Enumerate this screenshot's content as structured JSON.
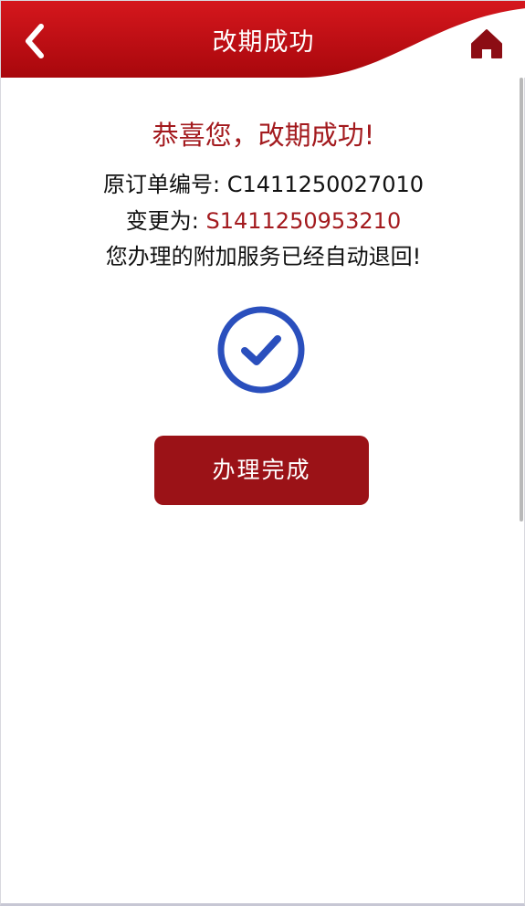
{
  "header": {
    "title": "改期成功",
    "back_icon": "chevron-left-icon",
    "home_icon": "home-icon",
    "bg_color": "#c8141a",
    "curve_color": "#ffffff"
  },
  "message": {
    "congrats": "恭喜您，改期成功!",
    "original_order_label": "原订单编号:",
    "original_order_no": "C1411250027010",
    "changed_to_label": "变更为:",
    "changed_to_no": "S1411250953210",
    "notice": "您办理的附加服务已经自动退回!"
  },
  "status_icon": "check-circle-icon",
  "accent_blue": "#2a4fbd",
  "done_button": {
    "label": "办理完成",
    "color": "#9b1217"
  }
}
